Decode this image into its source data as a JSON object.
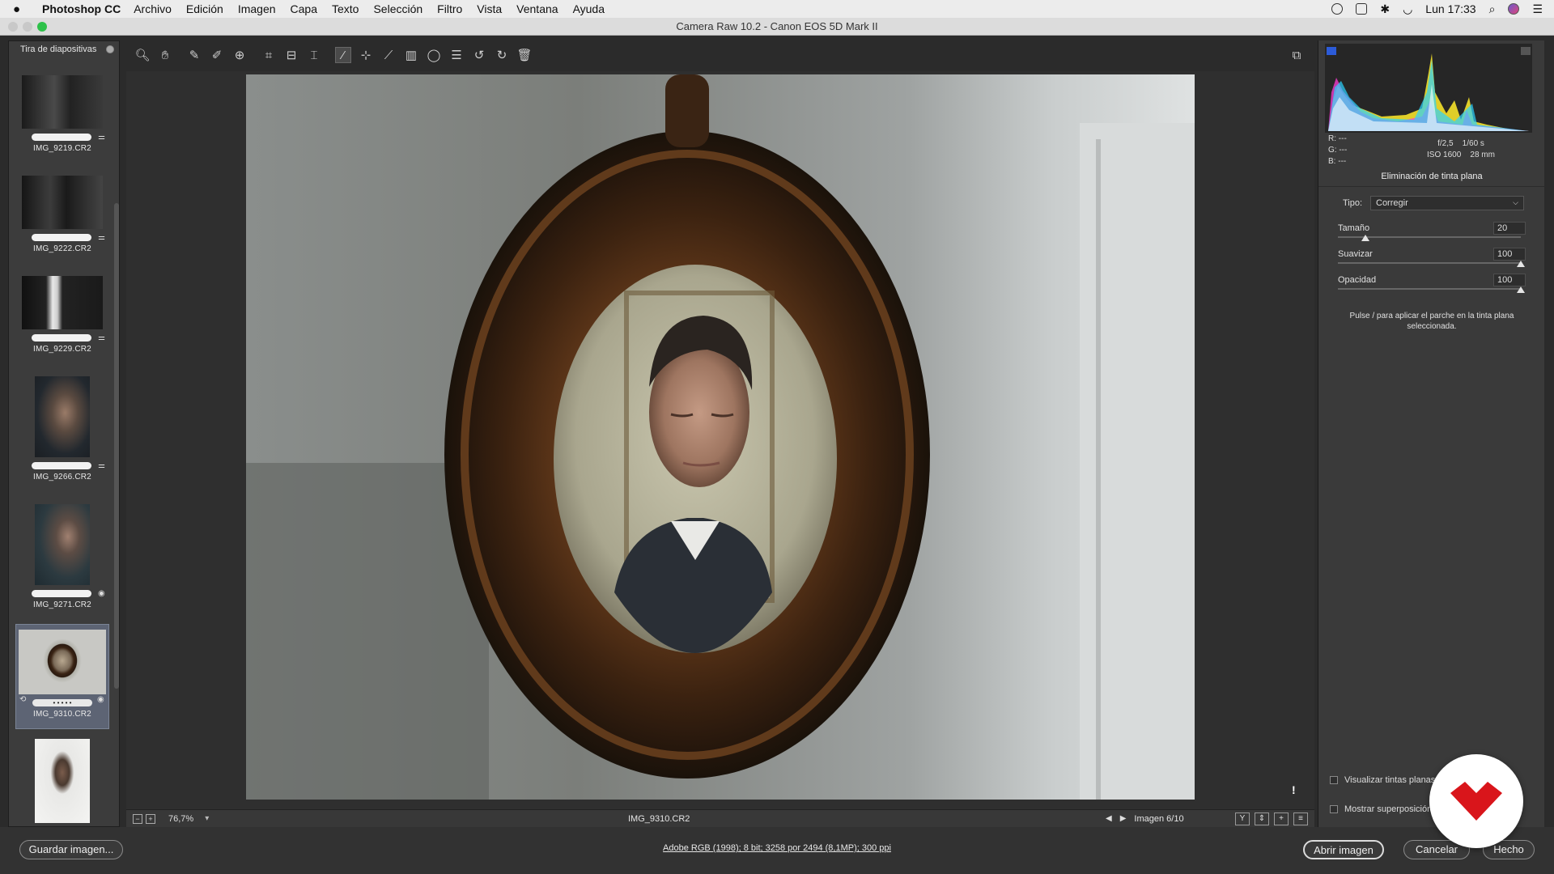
{
  "menubar": {
    "app_name": "Photoshop CC",
    "menus": [
      "Archivo",
      "Edición",
      "Imagen",
      "Capa",
      "Texto",
      "Selección",
      "Filtro",
      "Vista",
      "Ventana",
      "Ayuda"
    ],
    "clock": "Lun 17:33"
  },
  "window": {
    "title": "Camera Raw 10.2 - Canon EOS 5D Mark II"
  },
  "filmstrip": {
    "header": "Tira de diapositivas",
    "items": [
      {
        "name": "IMG_9219.CR2",
        "stars": 0
      },
      {
        "name": "IMG_9222.CR2",
        "stars": 0
      },
      {
        "name": "IMG_9229.CR2",
        "stars": 0
      },
      {
        "name": "IMG_9266.CR2",
        "stars": 0
      },
      {
        "name": "IMG_9271.CR2",
        "stars": 0
      },
      {
        "name": "IMG_9310.CR2",
        "stars": 0,
        "rating_dots": "• • • • •",
        "selected": true
      },
      {
        "name": "",
        "stars": 0
      }
    ]
  },
  "toolbar": {
    "tools": [
      "zoom-icon",
      "hand-icon",
      "white-balance-icon",
      "color-sampler-icon",
      "targeted-adjustment-icon",
      "crop-icon",
      "straighten-icon",
      "transform-icon",
      "spot-removal-icon",
      "red-eye-icon",
      "adjustment-brush-icon",
      "graduated-filter-icon",
      "radial-filter-icon",
      "preferences-icon",
      "rotate-left-icon",
      "rotate-right-icon",
      "trash-icon"
    ],
    "active_tool": "spot-removal-icon"
  },
  "statusbar": {
    "zoom": "76,7%",
    "filename": "IMG_9310.CR2",
    "counter": "Imagen 6/10",
    "view_buttons": [
      "Y",
      "⇕",
      "+",
      "≡"
    ]
  },
  "histogram": {
    "rgb": {
      "r_label": "R:",
      "g_label": "G:",
      "b_label": "B:",
      "r": "---",
      "g": "---",
      "b": "---"
    },
    "aperture": "f/2,5",
    "shutter": "1/60 s",
    "iso": "ISO 1600",
    "focal": "28 mm"
  },
  "panel": {
    "title": "Eliminación de tinta plana",
    "type_label": "Tipo:",
    "type_value": "Corregir",
    "sliders": [
      {
        "label": "Tamaño",
        "value": "20",
        "position": 0.15
      },
      {
        "label": "Suavizar",
        "value": "100",
        "position": 1.0
      },
      {
        "label": "Opacidad",
        "value": "100",
        "position": 1.0
      }
    ],
    "help_text": "Pulse / para aplicar el parche en la tinta plana seleccionada.",
    "visualize_label": "Visualizar tintas planas",
    "overlay_label": "Mostrar superposición"
  },
  "bottombar": {
    "save_label": "Guardar imagen...",
    "workflow": "Adobe RGB (1998); 8 bit; 3258 por 2494 (8,1MP); 300 ppi",
    "open_label": "Abrir imagen",
    "cancel_label": "Cancelar",
    "done_label": "Hecho"
  },
  "colors": {
    "accent_red": "#d9151b",
    "panel_bg": "#3a3a3a",
    "preview_bg": "#2f2f2f"
  }
}
